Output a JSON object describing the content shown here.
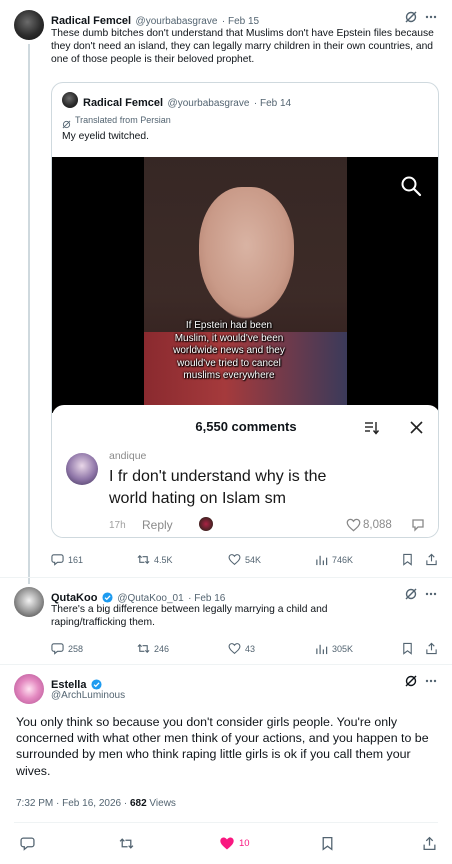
{
  "post1": {
    "name": "Radical Femcel",
    "handle": "@yourbabasgrave",
    "date": "· Feb 15",
    "text": "These dumb bitches don't understand that Muslims don't have Epstein files because they don't need an island, they can legally marry children in their own countries, and one of those people is their beloved prophet.",
    "quote": {
      "name": "Radical Femcel",
      "handle": "@yourbabasgrave",
      "date": "· Feb 14",
      "translated": "Translated from Persian",
      "text": "My eyelid twitched.",
      "video_caption": "If Epstein had been Muslim, it would've been worldwide news and they would've tried to cancel muslims everywhere",
      "comments_count": "6,550 comments",
      "comment": {
        "user": "andique",
        "text": "I fr don't understand why is the world hating on Islam sm",
        "time": "17h",
        "reply": "Reply",
        "likes": "8,088"
      }
    },
    "stats": {
      "replies": "161",
      "reposts": "4.5K",
      "likes": "54K",
      "views": "746K"
    }
  },
  "post2": {
    "name": "QutaKoo",
    "handle": "@QutaKoo_01",
    "date": "· Feb 16",
    "text": "There's a big difference between legally marrying a child and raping/trafficking them.",
    "stats": {
      "replies": "258",
      "reposts": "246",
      "likes": "43",
      "views": "305K"
    }
  },
  "post3": {
    "name": "Estella",
    "handle": "@ArchLuminous",
    "text": "You only think so because you don't consider girls people. You're only concerned with what other men think of your actions, and you happen to be surrounded by men who think raping little girls is ok if you call them your wives.",
    "time": "7:32 PM · Feb 16, 2026 · ",
    "views_count": "682",
    "views_label": " Views",
    "likes": "10"
  },
  "colors": {
    "accent": "#1d9bf0",
    "like": "#f91880",
    "muted": "#536471"
  }
}
